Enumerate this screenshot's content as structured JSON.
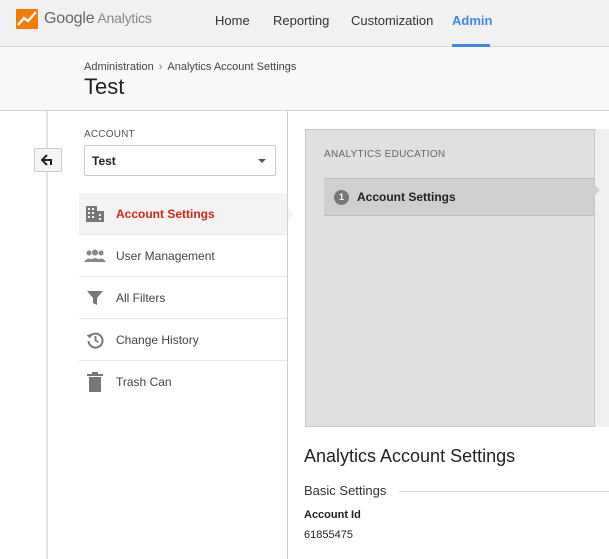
{
  "app": {
    "logo_brand": "Google",
    "logo_product": "Analytics"
  },
  "nav": {
    "items": [
      {
        "label": "Home"
      },
      {
        "label": "Reporting"
      },
      {
        "label": "Customization"
      },
      {
        "label": "Admin",
        "active": true
      }
    ]
  },
  "header": {
    "breadcrumb": [
      "Administration",
      "Analytics Account Settings"
    ],
    "breadcrumb_sep": "›",
    "title": "Test"
  },
  "sidebar": {
    "account_label": "ACCOUNT",
    "account_selected": "Test",
    "items": [
      {
        "label": "Account Settings",
        "icon": "building-icon",
        "active": true
      },
      {
        "label": "User Management",
        "icon": "users-icon"
      },
      {
        "label": "All Filters",
        "icon": "filter-icon"
      },
      {
        "label": "Change History",
        "icon": "history-icon"
      },
      {
        "label": "Trash Can",
        "icon": "trash-icon"
      }
    ]
  },
  "education": {
    "title": "ANALYTICS EDUCATION",
    "item_number": "1",
    "item_label": "Account Settings"
  },
  "settings": {
    "title": "Analytics Account Settings",
    "section": "Basic Settings",
    "account_id_label": "Account Id",
    "account_id_value": "61855475"
  },
  "colors": {
    "accent": "#4285f4",
    "active_menu": "#d0271d",
    "logo_orange": "#f57c00"
  }
}
